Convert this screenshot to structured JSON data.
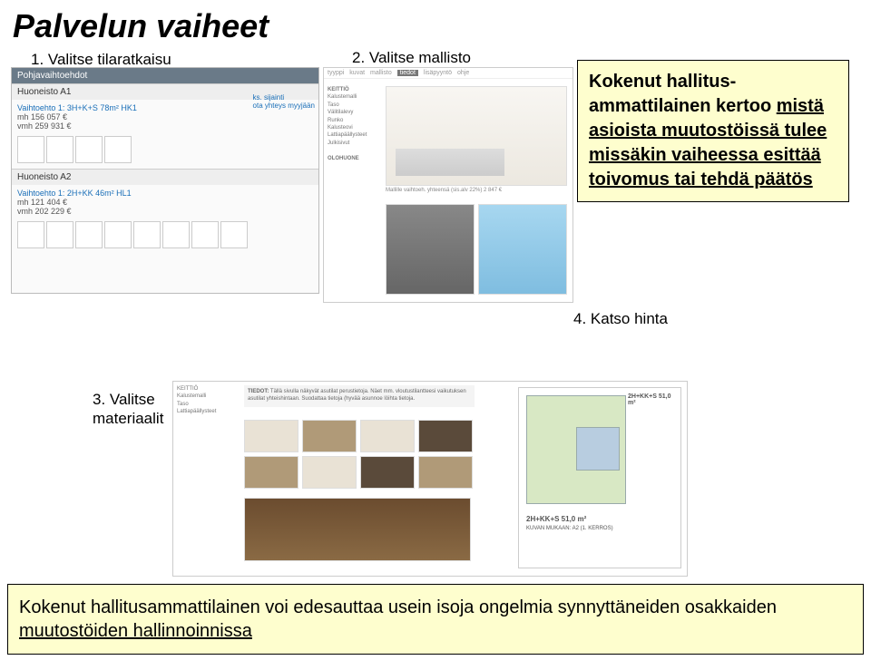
{
  "title": "Palvelun vaiheet",
  "steps": {
    "s1": "1. Valitse tilaratkaisu",
    "s2": "2. Valitse mallisto",
    "s3a": "3. Valitse",
    "s3b": "materiaalit",
    "s4": "4. Katso hinta"
  },
  "callout": {
    "l1": "Kokenut hallitus-",
    "l2": "ammattilainen kertoo ",
    "l3": "mistä asioista muutostöissä tulee missäkin vaiheessa esittää toivomus tai tehdä päätös"
  },
  "footer": {
    "a": "Kokenut hallitusammattilainen voi edesauttaa usein isoja ongelmia synnyttäneiden osakkaiden ",
    "b": "muutostöiden hallinnoinnissa"
  },
  "panel1": {
    "hdr": "Pohjavaihtoehdot",
    "apt1": "Huoneisto A1",
    "opt1": "Vaihtoehto 1: 3H+K+S 78m² HK1",
    "p1a": "mh 156 057 €",
    "p1b": "vmh 259 931 €",
    "side1": "ks. sijainti",
    "side2": "ota yhteys myyjään",
    "apt2": "Huoneisto A2",
    "opt2": "Vaihtoehto 1: 2H+KK 46m² HL1",
    "p2a": "mh 121 404 €",
    "p2b": "vmh 202 229 €"
  },
  "panel2": {
    "tabs": [
      "tyyppi",
      "kuvat",
      "mallisto",
      "tiedot",
      "lisäpyyntö",
      "ohje"
    ],
    "left_hdr": "KEITTIÖ",
    "left_items": [
      "Kalustemalli",
      "Taso",
      "Välitilalevy",
      "Runko",
      "Kalusteovi",
      "Lattiapäällysteet",
      "Julkisivut"
    ],
    "price_line": "Mallille vaihtoeh. yhteensä (sis.alv 22%) 2 847 €",
    "olohuone": "OLOHUONE"
  },
  "panel3": {
    "tiedot_lbl": "TIEDOT:",
    "tiedot_txt": "Tällä sivulla näkyvät asutilat perustietoja. Näet mm. vloutustilantteesi vaikutuksen asutilat yhteishintaan. Suodattaa tietoja (hyvää asunnoe löihta tietoja.",
    "fp_area": "2H+KK+S 51,0 m²",
    "fp_lbl": "2H+KK+S 51,0 m²",
    "fp_sub": "KUVAN MUKAAN: A2 (1. KERROS)"
  }
}
